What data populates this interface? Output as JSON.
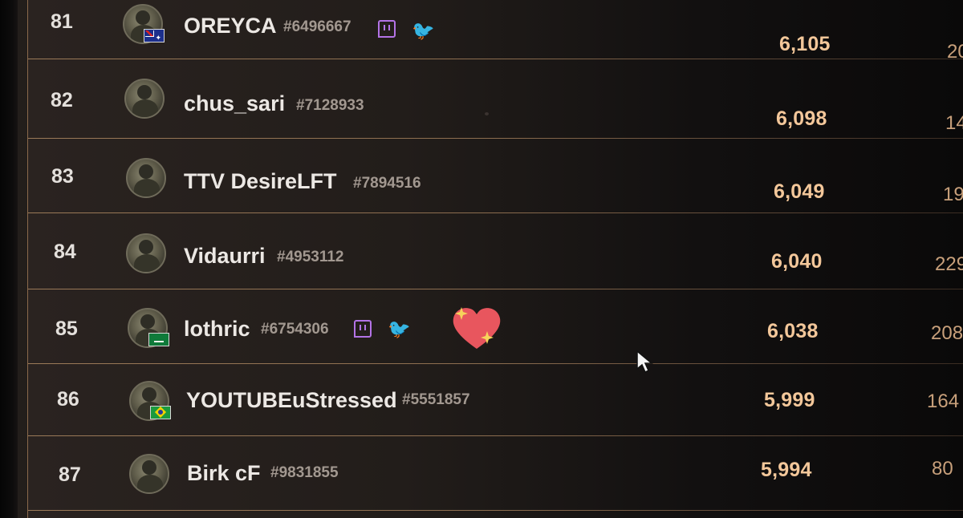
{
  "leaderboard": {
    "rows": [
      {
        "rank": "81",
        "name": "OREYCA",
        "tag": "#6496667",
        "score": "6,105",
        "extra": "20",
        "flag": "australia-flag"
      },
      {
        "rank": "82",
        "name": "chus_sari",
        "tag": "#7128933",
        "score": "6,098",
        "extra": "14",
        "flag": ""
      },
      {
        "rank": "83",
        "name": "TTV DesireLFT",
        "tag": "#7894516",
        "score": "6,049",
        "extra": "19",
        "flag": ""
      },
      {
        "rank": "84",
        "name": "Vidaurri",
        "tag": "#4953112",
        "score": "6,040",
        "extra": "229",
        "flag": ""
      },
      {
        "rank": "85",
        "name": "lothric",
        "tag": "#6754306",
        "score": "6,038",
        "extra": "208",
        "flag": "saudi-arabia-flag"
      },
      {
        "rank": "86",
        "name": "YOUTUBEuStressed",
        "tag": "#5551857",
        "score": "5,999",
        "extra": "164",
        "flag": "brazil-flag"
      },
      {
        "rank": "87",
        "name": "Birk cF",
        "tag": "#9831855",
        "score": "5,994",
        "extra": "80",
        "flag": ""
      }
    ]
  },
  "colors": {
    "name": "#ece8e4",
    "score": "#f3c79a",
    "separator": "#9b7a58",
    "twitch": "#b373e6",
    "twitter": "#35a8e8"
  },
  "icons": {
    "twitch": "twitch-icon",
    "twitter": "twitter-icon",
    "overlay": "sparkling-heart-icon",
    "cursor": "mouse-cursor-icon"
  }
}
